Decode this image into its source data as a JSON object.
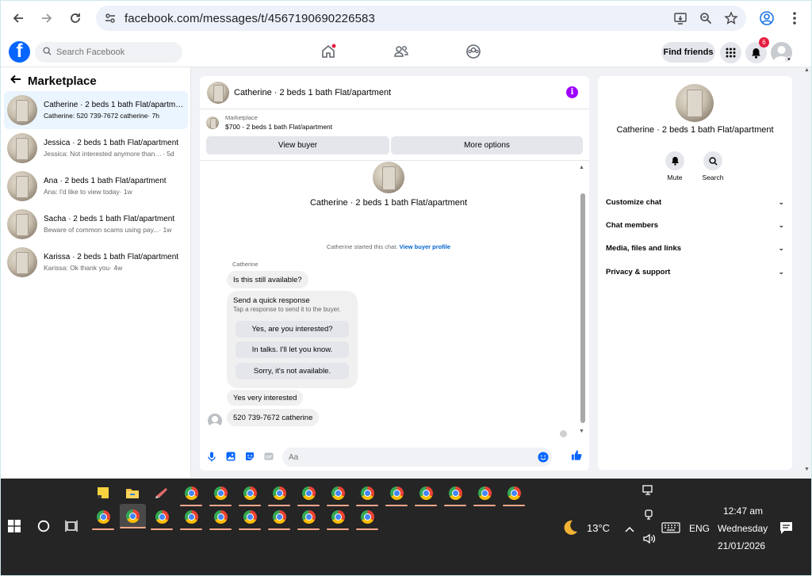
{
  "browser": {
    "url": "facebook.com/messages/t/4567190690226583"
  },
  "fb": {
    "search_placeholder": "Search Facebook",
    "find_friends": "Find friends",
    "notification_count": "6"
  },
  "left": {
    "title": "Marketplace",
    "conversations": [
      {
        "name": "Catherine · 2 beds 1 bath Flat/apartment",
        "message": "Catherine: 520 739-7672 catherine",
        "time": "· 7h"
      },
      {
        "name": "Jessica · 2 beds 1 bath Flat/apartment",
        "message": "Jessica: Not interested anymore thank...",
        "time": "· 5d"
      },
      {
        "name": "Ana · 2 beds 1 bath Flat/apartment",
        "message": "Ana: I'd like to view today",
        "time": "· 1w"
      },
      {
        "name": "Sacha · 2 beds 1 bath Flat/apartment",
        "message": "Beware of common scams using pay...",
        "time": " · 1w"
      },
      {
        "name": "Karissa · 2 beds 1 bath Flat/apartment",
        "message": "Karissa: Ok thank you",
        "time": "· 4w"
      }
    ]
  },
  "chat": {
    "title": "Catherine · 2 beds 1 bath Flat/apartment",
    "marketplace_label": "Marketplace",
    "listing": "$700 - 2 beds 1 bath Flat/apartment",
    "view_buyer": "View buyer",
    "more_options": "More options",
    "started_text": "Catherine started this chat.",
    "view_profile": "View buyer profile",
    "sender": "Catherine",
    "msg1": "Is this still available?",
    "quick_title": "Send a quick response",
    "quick_sub": "Tap a response to send it to the buyer.",
    "quick_replies": [
      "Yes, are you interested?",
      "In talks. I'll let you know.",
      "Sorry, it's not available."
    ],
    "msg2": "Yes very interested",
    "msg3": "520 739-7672 catherine",
    "composer_placeholder": "Aa"
  },
  "right": {
    "title": "Catherine · 2 beds 1 bath Flat/apartment",
    "mute": "Mute",
    "search": "Search",
    "menu": [
      "Customize chat",
      "Chat members",
      "Media, files and links",
      "Privacy & support"
    ]
  },
  "taskbar": {
    "temperature": "13°C",
    "language": "ENG",
    "time": "12:47 am",
    "day": "Wednesday",
    "date": "21/01/2026"
  },
  "colors": {
    "fb_blue": "#0866ff",
    "active_conv_bg": "#ebf5ff",
    "info_purple": "#9d00ff",
    "notif_red": "#e41e3f"
  }
}
